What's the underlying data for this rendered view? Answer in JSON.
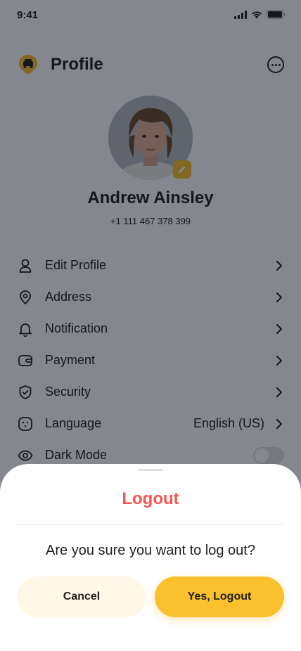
{
  "status_bar": {
    "time": "9:41"
  },
  "header": {
    "title": "Profile"
  },
  "profile": {
    "name": "Andrew Ainsley",
    "phone": "+1 111 467 378 399"
  },
  "menu": {
    "items": [
      {
        "label": "Edit Profile",
        "icon": "user-icon"
      },
      {
        "label": "Address",
        "icon": "location-pin-icon"
      },
      {
        "label": "Notification",
        "icon": "bell-icon"
      },
      {
        "label": "Payment",
        "icon": "wallet-icon"
      },
      {
        "label": "Security",
        "icon": "shield-icon"
      },
      {
        "label": "Language",
        "icon": "language-icon",
        "value": "English (US)"
      },
      {
        "label": "Dark Mode",
        "icon": "eye-icon",
        "toggle": false
      }
    ]
  },
  "logout_sheet": {
    "title": "Logout",
    "question": "Are you sure you want to log out?",
    "cancel_label": "Cancel",
    "confirm_label": "Yes, Logout"
  },
  "colors": {
    "accent": "#FBC02D",
    "danger": "#F75555",
    "cancel_bg": "#FFF8E6",
    "text": "#212121"
  }
}
